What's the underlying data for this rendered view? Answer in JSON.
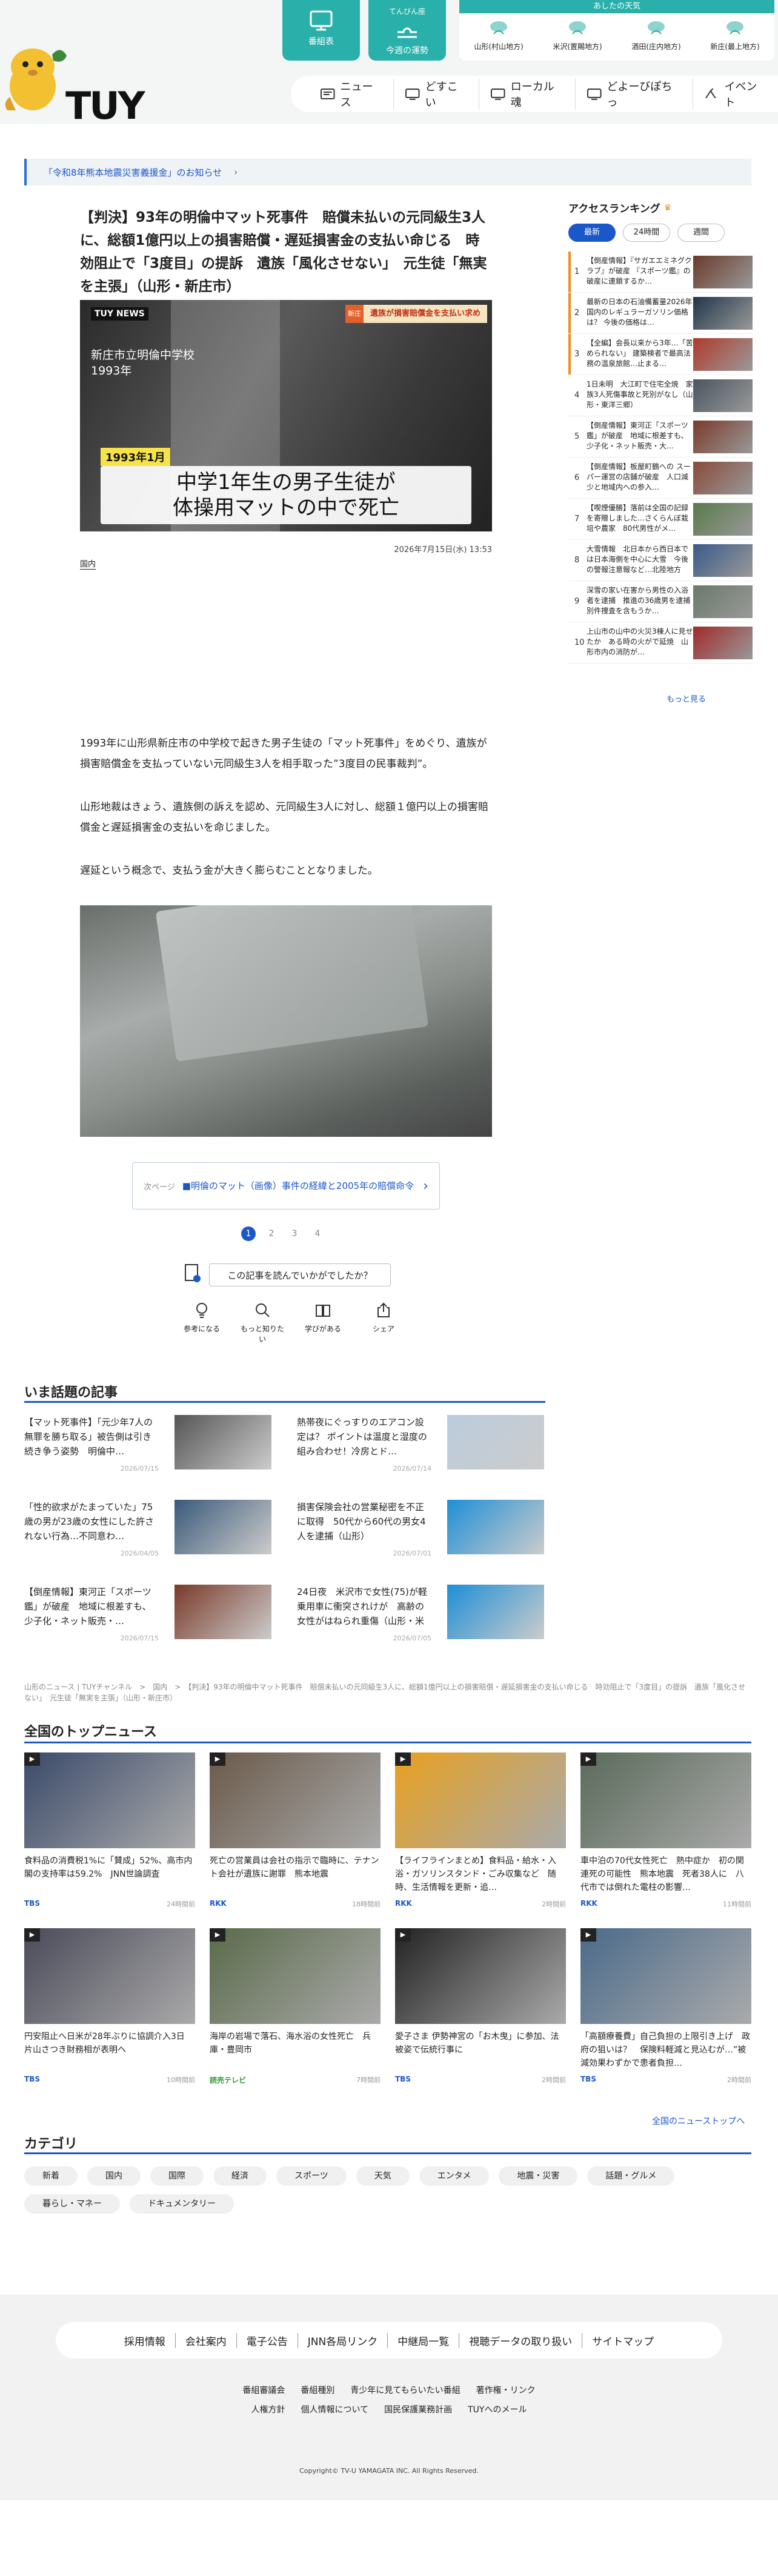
{
  "header": {
    "logo_text": "TUY",
    "nav_top": [
      {
        "label": "番組表",
        "icon": "tv-icon"
      },
      {
        "label": "今週の運勢",
        "sub": "てんびん座",
        "icon": "libra-icon"
      }
    ],
    "weather": {
      "title": "あしたの天気",
      "cells": [
        {
          "label": "山形(村山地方)"
        },
        {
          "label": "米沢(置賜地方)"
        },
        {
          "label": "酒田(庄内地方)"
        },
        {
          "label": "新庄(最上地方)"
        }
      ]
    },
    "nav": [
      {
        "label": "ニュース",
        "icon": "news-icon"
      },
      {
        "label": "どすこい",
        "icon": "tv-icon"
      },
      {
        "label": "ローカル魂",
        "icon": "tv-icon"
      },
      {
        "label": "どよーびぽちっ",
        "icon": "tv-icon"
      },
      {
        "label": "イベント",
        "icon": "event-icon"
      }
    ]
  },
  "notice": {
    "label": "「令和8年熊本地震災害義援金」のお知らせ",
    "chevron": "›"
  },
  "article": {
    "title": "【判決】93年の明倫中マット死事件　賠償未払いの元同級生3人に、総額1億円以上の損害賠償・遅延損害金の支払い命じる　時効阻止で「3度目」の提訴　遺族「風化させない」　元生徒「無実を主張」（山形・新庄市）",
    "image": {
      "logo": "TUY NEWS",
      "caption_tl": "新庄市立明倫中学校\n1993年",
      "badge": "1993年1月",
      "tag": "新庄",
      "top_banner": "遺族が損害賠償金を支払い求め",
      "caption_l1": "中学1年生の男子生徒が",
      "caption_l2": "体操用マットの中で死亡"
    },
    "date": "2026年7月15日(水) 13:53",
    "category": "国内",
    "paragraphs": [
      "1993年に山形県新庄市の中学校で起きた男子生徒の「マット死事件」をめぐり、遺族が損害賠償金を支払っていない元同級生3人を相手取った”3度目の民事裁判”。",
      "山形地裁はきょう、遺族側の訴えを認め、元同級生3人に対し、総額１億円以上の損害賠償金と遅延損害金の支払いを命じました。",
      "遅延という概念で、支払う金が大きく膨らむこととなりました。"
    ],
    "next_prefix": "次ページ",
    "next_label": "■明倫のマット（画像）事件の経緯と2005年の賠償命令",
    "pages": [
      "1",
      "2",
      "3",
      "4"
    ],
    "feedback": "この記事を読んでいかがでしたか？",
    "reactions": [
      {
        "label": "参考になる",
        "icon": "lightbulb-icon"
      },
      {
        "label": "もっと知りたい",
        "icon": "search-icon"
      },
      {
        "label": "学びがある",
        "icon": "book-icon"
      },
      {
        "label": "シェア",
        "icon": "share-icon"
      }
    ]
  },
  "ranking": {
    "title": "アクセスランキング",
    "tabs": [
      "最新",
      "24時間",
      "週間"
    ],
    "items": [
      {
        "n": "1",
        "t": "【倒産情報】『サガエエミネグクラブ』が破産 『スポーツ鑑』の破産に連鎖するか…",
        "c": "#6a3a2a"
      },
      {
        "n": "2",
        "t": "最新の日本の石油備蓄量2026年 国内のレギュラーガソリン価格は？ 今後の価格は…",
        "c": "#20354a"
      },
      {
        "n": "3",
        "t": "【全編】会長以来から3年…「苦められない」 建築検者で最高法務の温泉旅館…止まる…",
        "c": "#b03a2a"
      },
      {
        "n": "4",
        "t": "1日未明　大江町で住宅全焼　家族3人死傷事故と死別がなし（山形・東洋三郷）",
        "c": "#4a5560"
      },
      {
        "n": "5",
        "t": "【倒産情報】東河正「スポーツ鑑」が破産　地域に根差すも、少子化・ネット販売・大…",
        "c": "#7a3a2a"
      },
      {
        "n": "6",
        "t": "【倒産情報】板屋町鶴への スーパー運営の店舗が破産　人口減少と地域内への参入…",
        "c": "#8a4a3a"
      },
      {
        "n": "7",
        "t": "【喫煙優勝】落前は全国の記録を寄贈しました…さくらんぼ栽培や農家　80代男性がメ…",
        "c": "#5a7a4a"
      },
      {
        "n": "8",
        "t": "大雪情報　北日本から西日本では日本海側を中心に大雪　今後の警報注意報など…北陸地方",
        "c": "#3a5a8a"
      },
      {
        "n": "9",
        "t": "深雪の家い在害から男性の入浴者を逮捕　推進の36歳男を逮捕　別件捜査を含もうか…",
        "c": "#6a7a6a"
      },
      {
        "n": "10",
        "t": "上山市の山中の火災3棟人に見せたか　ある時の火がで延焼　山形市内の消防が…",
        "c": "#a02a2a"
      }
    ],
    "more": "もっと見る"
  },
  "trending": {
    "title": "いま話題の記事",
    "items": [
      {
        "t": "【マット死事件】「元少年7人の無罪を勝ち取る」被告側は引き続き争う姿勢　明倫中…",
        "d": "2026/07/15",
        "c": "#555"
      },
      {
        "t": "熱帯夜にぐっすりのエアコン設定は？ ポイントは温度と湿度の組み合わせ！冷房とド…",
        "d": "2026/07/14",
        "c": "#bcd"
      },
      {
        "t": "「性的欲求がたまっていた」75歳の男が23歳の女性にした許されない行為…不同意わ…",
        "d": "2026/04/05",
        "c": "#3a5a7a"
      },
      {
        "t": "損害保険会社の営業秘密を不正に取得　50代から60代の男女4人を逮捕（山形）",
        "d": "2026/07/01",
        "c": "#1e8fd6"
      },
      {
        "t": "【倒産情報】東河正「スポーツ鑑」が破産　地域に根差すも、少子化・ネット販売・…",
        "d": "2026/07/15",
        "c": "#7a3a2a"
      },
      {
        "t": "24日夜　米沢市で女性(75)が軽乗用車に衝突されけが　高齢の女性がはねられ重傷（山形・米沢署）",
        "d": "2026/07/05",
        "c": "#1e8fd6"
      }
    ]
  },
  "breadcrumb": "山形のニュース | TUYチャンネル　>　国内　>　【判決】93年の明倫中マット死事件　賠償未払いの元同級生3人に、総額1億円以上の損害賠償・遅延損害金の支払い命じる　時効阻止で「3度目」の提訴　遺族「風化させない」　元生徒「無実を主張」（山形・新庄市）",
  "topnews": {
    "title": "全国のトップニュース",
    "items": [
      {
        "t": "食料品の消費税1%に「賛成」52%、高市内閣の支持率は59.2%　JNN世論調査",
        "s": "TBS",
        "tm": "24時間前",
        "c": "#3a4a6a"
      },
      {
        "t": "死亡の営業員は会社の指示で臨時に、テナント会社が遺族に謝罪　熊本地震",
        "s": "RKK",
        "tm": "18時間前",
        "c": "#6a5a4a"
      },
      {
        "t": "【ライフラインまとめ】食料品・給水・入浴・ガソリンスタンド・ごみ収集など　随時、生活情報を更新・追…",
        "s": "RKK",
        "tm": "2時間前",
        "c": "#e8a020"
      },
      {
        "t": "車中泊の70代女性死亡　熱中症か　初の関連死の可能性　熊本地震　死者38人に　八代市では倒れた電柱の影響…",
        "s": "RKK",
        "tm": "11時間前",
        "c": "#5a6a5a"
      },
      {
        "t": "円安阻止へ日米が28年ぶりに協調介入3日 片山さつき財務相が表明へ",
        "s": "TBS",
        "tm": "10時間前",
        "c": "#4a4a5a"
      },
      {
        "t": "海岸の岩場で落石、海水浴の女性死亡　兵庫・豊岡市",
        "s": "読売テレビ",
        "tm": "7時間前",
        "c": "#5a6a4a"
      },
      {
        "t": "愛子さま 伊勢神宮の「お木曳」に参加、法被姿で伝統行事に",
        "s": "TBS",
        "tm": "2時間前",
        "c": "#222"
      },
      {
        "t": "「高額療養費」自己負担の上限引き上げ　政府の狙いは？　保険料軽減と見込むが…”被減効果わずかで患者負担…",
        "s": "TBS",
        "tm": "2時間前",
        "c": "#4a6a8a"
      }
    ],
    "more": "全国のニューストップへ"
  },
  "categories": {
    "title": "カテゴリ",
    "items": [
      "新着",
      "国内",
      "国際",
      "経済",
      "スポーツ",
      "天気",
      "エンタメ",
      "地震・災害",
      "話題・グルメ",
      "暮らし・マネー",
      "ドキュメンタリー"
    ]
  },
  "footer": {
    "bar": [
      "採用情報",
      "会社案内",
      "電子公告",
      "JNN各局リンク",
      "中継局一覧",
      "視聴データの取り扱い",
      "サイトマップ"
    ],
    "links1": [
      "番組審議会",
      "番組種別",
      "青少年に見てもらいたい番組",
      "著作権・リンク"
    ],
    "links2": [
      "人権方針",
      "個人情報について",
      "国民保護業務計画",
      "TUYへのメール"
    ],
    "copyright": "Copyright© TV-U YAMAGATA INC. All Rights Reserved."
  }
}
